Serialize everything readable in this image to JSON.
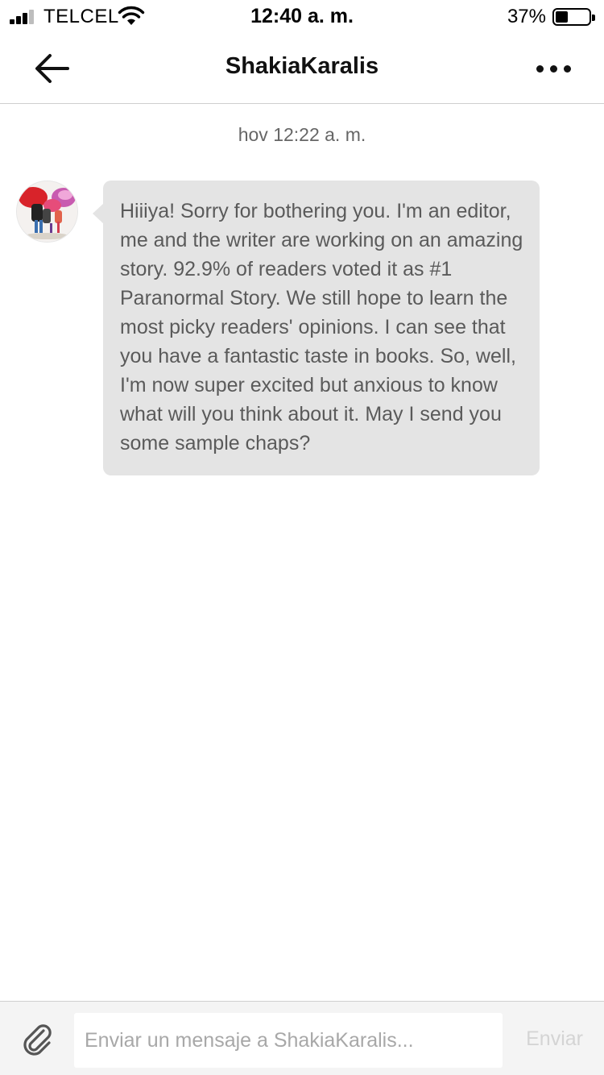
{
  "status_bar": {
    "carrier": "TELCEL",
    "time": "12:40 a. m.",
    "battery_percent": "37%",
    "battery_level": 0.37
  },
  "header": {
    "back_icon": "arrow-left-icon",
    "title": "ShakiaKaralis",
    "more_icon": "more-horizontal-icon"
  },
  "conversation": {
    "timestamp": "hov 12:22 a. m.",
    "messages": [
      {
        "sender": "ShakiaKaralis",
        "text": "Hiiiya! Sorry for bothering you. I'm an editor, me and the writer are working on an amazing story. 92.9% of readers voted it as #1 Paranormal Story. We still hope to learn the most picky readers' opinions. I can see that you have a fantastic taste in books. So, well, I'm now super excited but anxious to know what will you think about it. May I send you some sample chaps?"
      }
    ]
  },
  "composer": {
    "attach_icon": "paperclip-icon",
    "placeholder": "Enviar un mensaje a ShakiaKaralis...",
    "value": "",
    "send_label": "Enviar"
  },
  "colors": {
    "bubble_bg": "#e4e4e4",
    "bubble_text": "#5a5a5a",
    "composer_bg": "#f4f4f4",
    "send_disabled": "#d4d4d4"
  }
}
